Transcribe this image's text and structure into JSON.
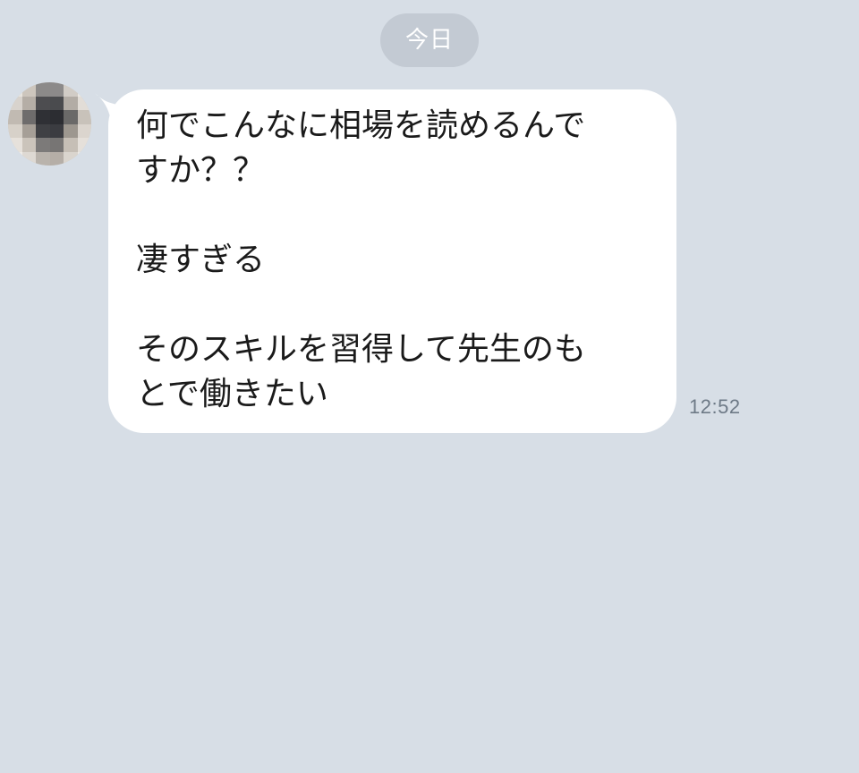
{
  "date_separator": {
    "label": "今日"
  },
  "message": {
    "lines": [
      "何でこんなに相場を読めるんで",
      "すか？？",
      "",
      "凄すぎる",
      "",
      "そのスキルを習得して先生のも",
      "とで働きたい"
    ],
    "time": "12:52"
  },
  "colors": {
    "background": "#d7dee6",
    "bubble": "#ffffff",
    "date_pill": "#c3cad3",
    "timestamp": "#6e7a87"
  }
}
